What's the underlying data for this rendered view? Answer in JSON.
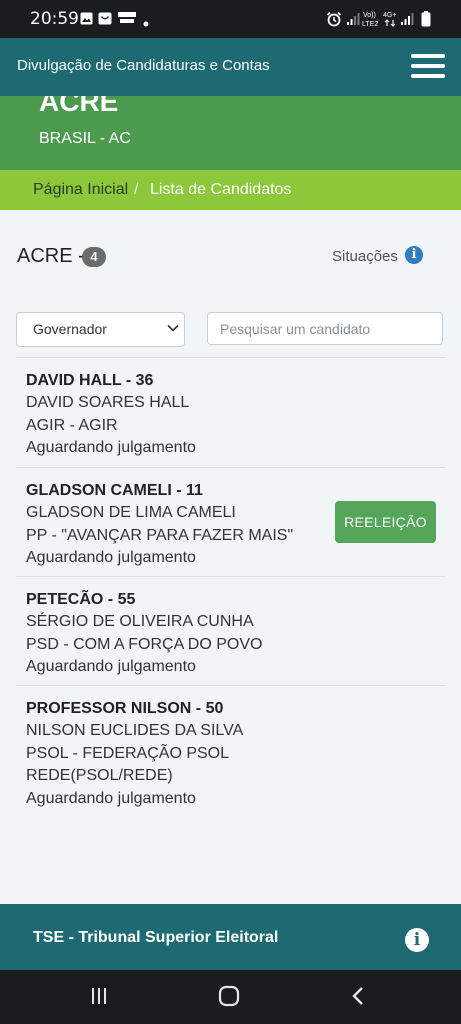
{
  "status_bar": {
    "time": "20:59",
    "icons": [
      "image-icon",
      "shopping-icon",
      "globoplay-icon",
      "dot-icon",
      "alarm-icon",
      "signal-icon",
      "volte-icon",
      "4g-icon",
      "signal-icon",
      "battery-icon"
    ]
  },
  "app_bar": {
    "title": "Divulgação de Candidaturas e Contas",
    "menu_icon": "hamburger-menu-icon"
  },
  "state_header": {
    "name": "ACRE",
    "subtitle": "BRASIL - AC"
  },
  "breadcrumb": {
    "home": "Página Inicial",
    "separator": "/",
    "current": "Lista de Candidatos"
  },
  "section": {
    "title": "ACRE -",
    "count": "4",
    "situations_label": "Situações",
    "info_icon": "info-circle-icon"
  },
  "filters": {
    "office_selected": "Governador",
    "search_placeholder": "Pesquisar um candidato",
    "search_value": ""
  },
  "candidates": [
    {
      "name": "DAVID HALL - 36",
      "full_name": "DAVID SOARES HALL",
      "party": "AGIR - AGIR",
      "status": "Aguardando julgamento"
    },
    {
      "name": "GLADSON CAMELI - 11",
      "full_name": "GLADSON DE LIMA CAMELI",
      "party": "PP - \"AVANÇAR PARA FAZER MAIS\"",
      "status": "Aguardando julgamento",
      "badge": "REELEIÇÃO"
    },
    {
      "name": "PETECÃO - 55",
      "full_name": "SÉRGIO DE OLIVEIRA CUNHA",
      "party": "PSD - COM A FORÇA DO POVO",
      "status": "Aguardando julgamento"
    },
    {
      "name": "PROFESSOR NILSON - 50",
      "full_name": "NILSON EUCLIDES DA SILVA",
      "party": "PSOL - FEDERAÇÃO PSOL",
      "party_line2": "REDE(PSOL/REDE)",
      "status": "Aguardando julgamento"
    }
  ],
  "footer": {
    "text": "TSE - Tribunal Superior Eleitoral",
    "info_icon": "info-circle-icon"
  },
  "nav_bar": {
    "icons": [
      "recent-apps-icon",
      "home-icon",
      "back-icon"
    ]
  },
  "colors": {
    "app_bar": "#1d6a73",
    "state_header": "#4c9a4d",
    "breadcrumb": "#8cc83a",
    "reelection_button": "#55a65a",
    "info_blue": "#2f7dc0"
  }
}
